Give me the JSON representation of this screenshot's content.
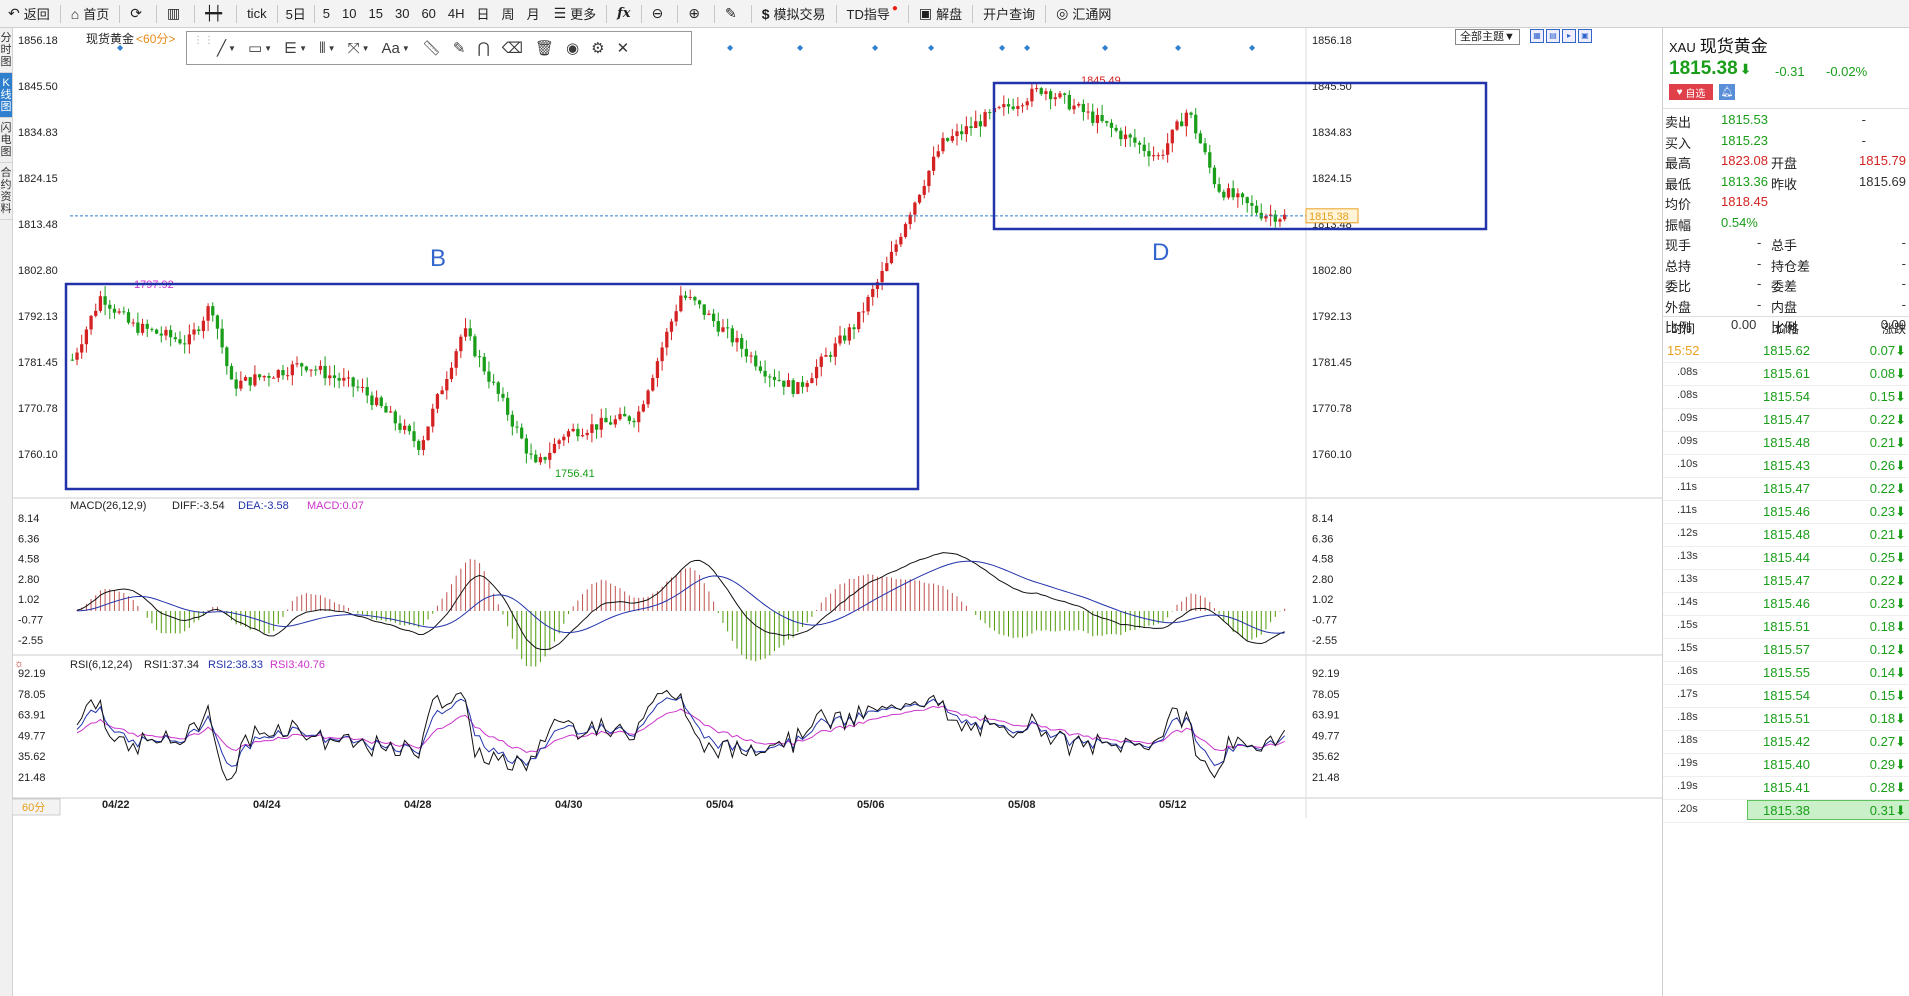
{
  "toolbar": {
    "back": "返回",
    "home": "首页",
    "tick": "tick",
    "periods": [
      "5日",
      "5",
      "10",
      "15",
      "30",
      "60",
      "4H",
      "日",
      "周",
      "月"
    ],
    "more": "更多",
    "fx": "fx",
    "sim_trade": "模拟交易",
    "td_guide": "TD指导",
    "analysis": "解盘",
    "account_query": "开户查询",
    "huitong": "汇通网"
  },
  "left_tabs": [
    "分时图",
    "K线图",
    "闪电图",
    "合约资料"
  ],
  "chart": {
    "title": "现货黄金",
    "period_tag": "<60分>",
    "theme": "全部主题▼",
    "bottom_period": "60分",
    "price_axis": [
      "1856.18",
      "1845.50",
      "1834.83",
      "1824.15",
      "1813.48",
      "1802.80",
      "1792.13",
      "1781.45",
      "1770.78",
      "1760.10"
    ],
    "dates": [
      "04/22",
      "04/24",
      "04/28",
      "04/30",
      "05/04",
      "05/06",
      "05/08",
      "05/12"
    ],
    "high_label": "1797.92",
    "low_label": "1756.41",
    "peak_label": "1845.49",
    "last_label": "1815.38",
    "box_b": "B",
    "box_d": "D",
    "macd_legend": {
      "name": "MACD(26,12,9)",
      "diff": "DIFF:-3.54",
      "dea": "DEA:-3.58",
      "macd": "MACD:0.07"
    },
    "macd_axis": [
      "8.14",
      "6.36",
      "4.58",
      "2.80",
      "1.02",
      "-0.77",
      "-2.55"
    ],
    "rsi_legend": {
      "name": "RSI(6,12,24)",
      "rsi1": "RSI1:37.34",
      "rsi2": "RSI2:38.33",
      "rsi3": "RSI3:40.76"
    },
    "rsi_axis": [
      "92.19",
      "78.05",
      "63.91",
      "49.77",
      "35.62",
      "21.48"
    ],
    "colors": {
      "up": "#d42222",
      "down": "#1a9e1a",
      "box": "#2233aa",
      "macd_red": "#c0504d",
      "macd_green": "#4e9a06",
      "rsi3": "#cc33cc"
    }
  },
  "panel": {
    "symbol": "XAU",
    "name": "现货黄金",
    "price": "1815.38",
    "change": "-0.31",
    "change_pct": "-0.02%",
    "fav_btn": "自选",
    "rows": [
      {
        "label": "卖出",
        "value": "1815.53",
        "label2": "",
        "value2": "-"
      },
      {
        "label": "买入",
        "value": "1815.23",
        "label2": "",
        "value2": "-"
      },
      {
        "label": "最高",
        "value": "1823.08",
        "label2": "开盘",
        "value2": "1815.79"
      },
      {
        "label": "最低",
        "value": "1813.36",
        "label2": "昨收",
        "value2": "1815.69"
      },
      {
        "label": "均价",
        "value": "1818.45",
        "label2": "",
        "value2": ""
      },
      {
        "label": "振幅",
        "value": "0.54%",
        "label2": "",
        "value2": ""
      },
      {
        "label": "现手",
        "value": "-",
        "label2": "总手",
        "value2": "-"
      },
      {
        "label": "总持",
        "value": "-",
        "label2": "持仓差",
        "value2": "-"
      },
      {
        "label": "委比",
        "value": "-",
        "label2": "委差",
        "value2": "-"
      },
      {
        "label": "外盘",
        "value": "-",
        "label2": "内盘",
        "value2": "-"
      },
      {
        "label": "比例",
        "value": "0.00",
        "label2": "比例",
        "value2": "0.00"
      }
    ],
    "tick_header": {
      "time": "时间",
      "price": "价格",
      "change": "涨跌"
    },
    "ticks": [
      {
        "time": "15:52",
        "price": "1815.62",
        "change": "0.07"
      },
      {
        "time": ".08s",
        "price": "1815.61",
        "change": "0.08"
      },
      {
        "time": ".08s",
        "price": "1815.54",
        "change": "0.15"
      },
      {
        "time": ".09s",
        "price": "1815.47",
        "change": "0.22"
      },
      {
        "time": ".09s",
        "price": "1815.48",
        "change": "0.21"
      },
      {
        "time": ".10s",
        "price": "1815.43",
        "change": "0.26"
      },
      {
        "time": ".11s",
        "price": "1815.47",
        "change": "0.22"
      },
      {
        "time": ".11s",
        "price": "1815.46",
        "change": "0.23"
      },
      {
        "time": ".12s",
        "price": "1815.48",
        "change": "0.21"
      },
      {
        "time": ".13s",
        "price": "1815.44",
        "change": "0.25"
      },
      {
        "time": ".13s",
        "price": "1815.47",
        "change": "0.22"
      },
      {
        "time": ".14s",
        "price": "1815.46",
        "change": "0.23"
      },
      {
        "time": ".15s",
        "price": "1815.51",
        "change": "0.18"
      },
      {
        "time": ".15s",
        "price": "1815.57",
        "change": "0.12"
      },
      {
        "time": ".16s",
        "price": "1815.55",
        "change": "0.14"
      },
      {
        "time": ".17s",
        "price": "1815.54",
        "change": "0.15"
      },
      {
        "time": ".18s",
        "price": "1815.51",
        "change": "0.18"
      },
      {
        "time": ".18s",
        "price": "1815.42",
        "change": "0.27"
      },
      {
        "time": ".19s",
        "price": "1815.40",
        "change": "0.29"
      },
      {
        "time": ".19s",
        "price": "1815.41",
        "change": "0.28"
      },
      {
        "time": ".20s",
        "price": "1815.38",
        "change": "0.31"
      }
    ]
  }
}
